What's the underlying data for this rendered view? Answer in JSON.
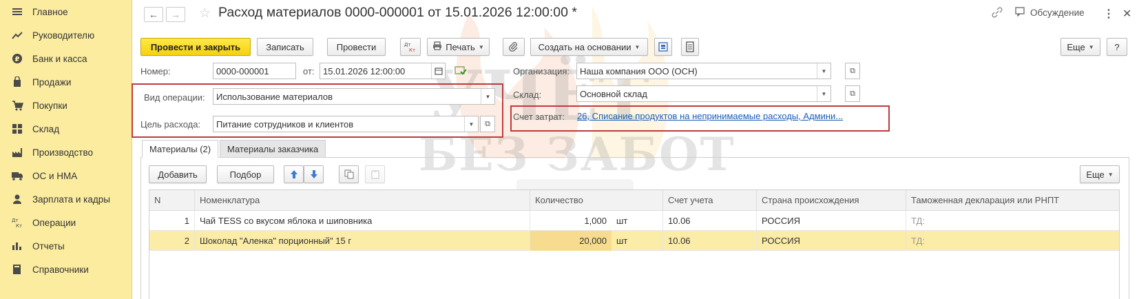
{
  "sidebar": {
    "items": [
      {
        "icon": "menu-icon",
        "label": "Главное"
      },
      {
        "icon": "trend-icon",
        "label": "Руководителю"
      },
      {
        "icon": "ruble-icon",
        "label": "Банк и касса"
      },
      {
        "icon": "bag-icon",
        "label": "Продажи"
      },
      {
        "icon": "cart-icon",
        "label": "Покупки"
      },
      {
        "icon": "grid-icon",
        "label": "Склад"
      },
      {
        "icon": "factory-icon",
        "label": "Производство"
      },
      {
        "icon": "truck-icon",
        "label": "ОС и НМА"
      },
      {
        "icon": "person-icon",
        "label": "Зарплата и кадры"
      },
      {
        "icon": "dtkt-icon",
        "label": "Операции"
      },
      {
        "icon": "bar-chart-icon",
        "label": "Отчеты"
      },
      {
        "icon": "book-icon",
        "label": "Справочники"
      }
    ]
  },
  "titlebar": {
    "title": "Расход материалов 0000-000001 от 15.01.2026 12:00:00 *",
    "discuss_label": "Обсуждение"
  },
  "toolbar": {
    "post_close": "Провести и закрыть",
    "save": "Записать",
    "post": "Провести",
    "dtkt": "Дт Кт",
    "print": "Печать",
    "create_based": "Создать на основании",
    "more": "Еще",
    "help": "?"
  },
  "form": {
    "number_label": "Номер:",
    "number_value": "0000-000001",
    "date_label": "от:",
    "date_value": "15.01.2026 12:00:00",
    "org_label": "Организация:",
    "org_value": "Наша компания ООО (ОСН)",
    "op_type_label": "Вид операции:",
    "op_type_value": "Использование материалов",
    "warehouse_label": "Склад:",
    "warehouse_value": "Основной склад",
    "purpose_label": "Цель расхода:",
    "purpose_value": "Питание сотрудников и клиентов",
    "cost_account_label": "Счет затрат:",
    "cost_account_value": "26, Списание продуктов на непринимаемые расходы, Админи..."
  },
  "tabs": [
    {
      "label": "Материалы (2)"
    },
    {
      "label": "Материалы заказчика"
    }
  ],
  "table_toolbar": {
    "add": "Добавить",
    "pick": "Подбор",
    "more": "Еще"
  },
  "table": {
    "headers": [
      "N",
      "Номенклатура",
      "Количество",
      "Счет учета",
      "Страна происхождения",
      "Таможенная декларация или РНПТ"
    ],
    "rows": [
      {
        "n": "1",
        "item": "Чай TESS со вкусом яблока и шиповника",
        "qty": "1,000",
        "unit": "шт",
        "account": "10.06",
        "country": "РОССИЯ",
        "customs": "ТД:"
      },
      {
        "n": "2",
        "item": "Шоколад \"Аленка\" порционный\" 15 г",
        "qty": "20,000",
        "unit": "шт",
        "account": "10.06",
        "country": "РОССИЯ",
        "customs": "ТД:"
      }
    ]
  },
  "watermark": {
    "line1": "УЧЁТ",
    "line2": "БЕЗ ЗАБОТ"
  },
  "colors": {
    "sidebar_bg": "#fbeca0",
    "primary_button": "#f5d10f",
    "selected_row": "#fbeca7",
    "highlight_frame": "#c0393b",
    "link": "#1b5db5"
  }
}
